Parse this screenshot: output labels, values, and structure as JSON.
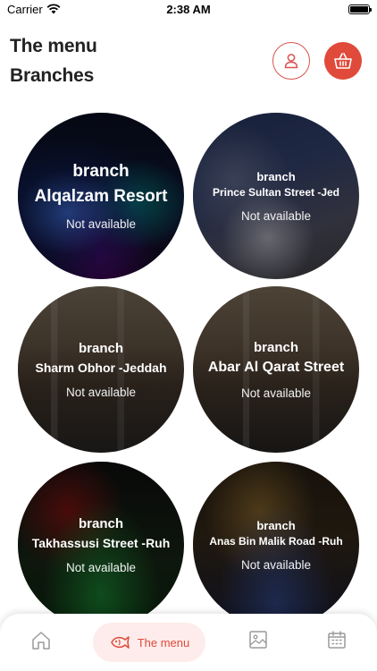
{
  "status_bar": {
    "carrier": "Carrier",
    "time": "2:38 AM"
  },
  "header": {
    "title_line1": "The menu",
    "title_line2": "Branches",
    "profile_icon": "user-icon",
    "cart_icon": "basket-icon",
    "accent_color": "#e04a3a"
  },
  "branches": [
    {
      "label": "branch",
      "name": "Alqalzam Resort",
      "status": "Not available"
    },
    {
      "label": "branch",
      "name": "Prince Sultan Street -Jed",
      "status": "Not available"
    },
    {
      "label": "branch",
      "name": "Sharm Obhor -Jeddah",
      "status": "Not available"
    },
    {
      "label": "branch",
      "name": "Abar Al Qarat Street",
      "status": "Not available"
    },
    {
      "label": "branch",
      "name": "Takhassusi Street -Ruh",
      "status": "Not available"
    },
    {
      "label": "branch",
      "name": "Anas Bin Malik Road -Ruh",
      "status": "Not available"
    }
  ],
  "bottom_nav": {
    "items": [
      {
        "icon": "home-icon"
      },
      {
        "icon": "fish-icon",
        "label": "The menu",
        "active": true
      },
      {
        "icon": "gallery-icon"
      },
      {
        "icon": "calendar-icon"
      }
    ]
  }
}
